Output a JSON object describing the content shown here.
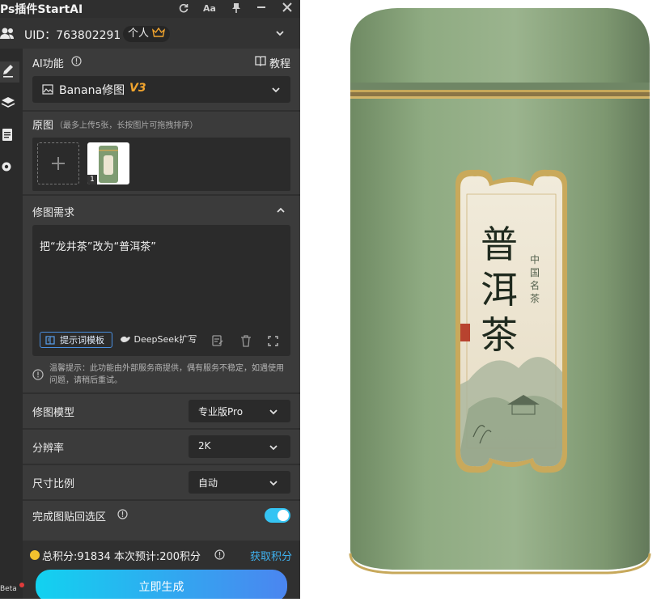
{
  "window": {
    "title": "Ps插件StartAI"
  },
  "header": {
    "uid_label": "UID：763802291",
    "plan_badge": "个人"
  },
  "ai_function": {
    "label": "AI功能",
    "tutorial": "教程",
    "selected_tool": "Banana修图",
    "version_tag": "V3"
  },
  "original": {
    "label": "原图",
    "hint": "（最多上传5张，长按图片可拖拽排序）",
    "thumb_index": "1"
  },
  "edit": {
    "label": "修图需求",
    "prompt_text": "把“龙井茶”改为“普洱茶”",
    "template_button": "提示词模板",
    "deepseek_button": "DeepSeek扩写",
    "notice": "温馨提示：此功能由外部服务商提供，偶有服务不稳定，如遇使用问题，请稍后重试。"
  },
  "settings": {
    "model": {
      "label": "修图模型",
      "value": "专业版Pro"
    },
    "resolution": {
      "label": "分辨率",
      "value": "2K"
    },
    "aspect": {
      "label": "尺寸比例",
      "value": "自动"
    },
    "paste_back": {
      "label": "完成图贴回选区",
      "enabled": true
    }
  },
  "footer": {
    "points": "总积分:91834  本次预计:200积分",
    "get_points": "获取积分",
    "generate": "立即生成",
    "beta": "Beta"
  },
  "canvas": {
    "tea_name": "普洱茶",
    "subtitle": "中国名茶"
  },
  "colors": {
    "accent": "#35c4f3",
    "panel_bg": "#3b3b3b",
    "gold": "#f2c12e",
    "tin": "#87a37a"
  }
}
